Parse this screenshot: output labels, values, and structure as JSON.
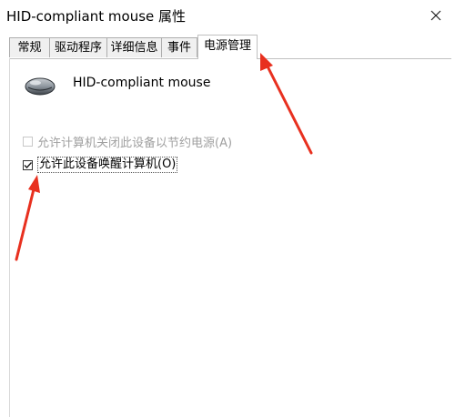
{
  "window": {
    "title": "HID-compliant mouse 属性"
  },
  "tabs": [
    {
      "label": "常规"
    },
    {
      "label": "驱动程序"
    },
    {
      "label": "详细信息"
    },
    {
      "label": "事件"
    },
    {
      "label": "电源管理",
      "active": true
    }
  ],
  "device": {
    "name": "HID-compliant mouse",
    "icon": "mouse-icon"
  },
  "power_options": {
    "allow_turn_off": {
      "label": "允许计算机关闭此设备以节约电源(A)",
      "checked": false,
      "enabled": false
    },
    "allow_wake": {
      "label": "允许此设备唤醒计算机(O)",
      "checked": true,
      "enabled": true
    }
  },
  "colors": {
    "annotation_arrow": "#e8301f",
    "checkmark": "#1a1a1a"
  }
}
